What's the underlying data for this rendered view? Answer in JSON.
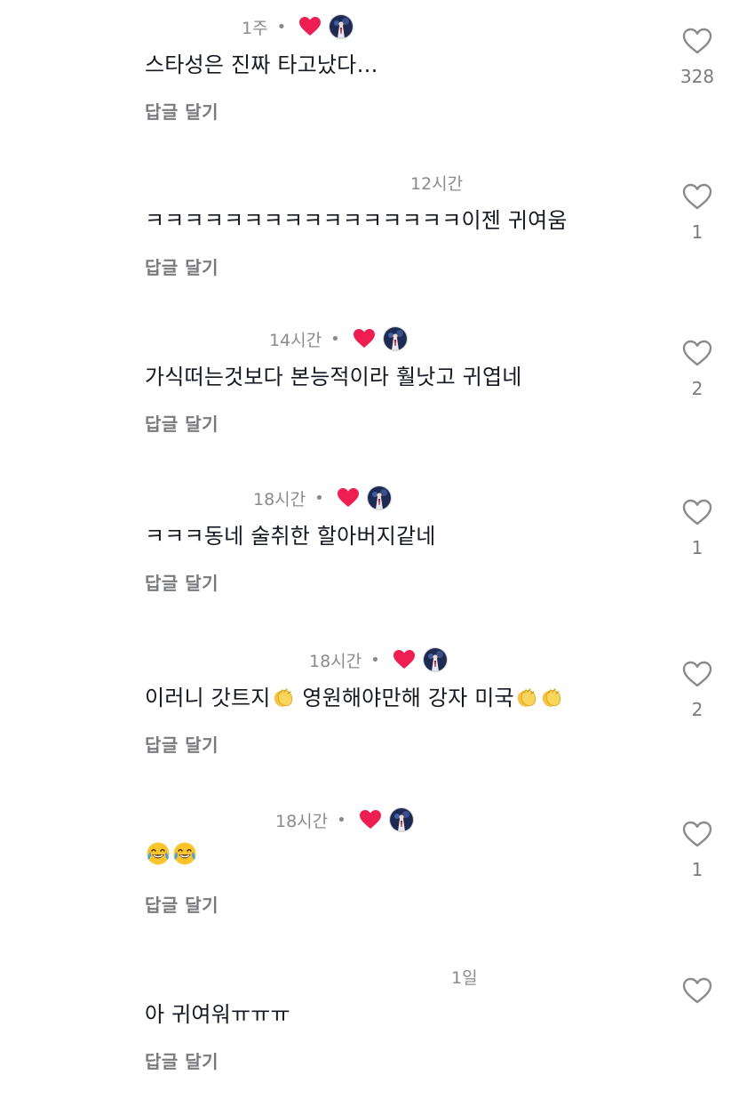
{
  "comments": [
    {
      "time": "1주",
      "creator_liked": true,
      "text_parts": [
        "스타성은 진짜 타고났다…"
      ],
      "reply_label": "답글 달기",
      "likes": "328"
    },
    {
      "time": "12시간",
      "creator_liked": false,
      "text_parts": [
        "ㅋㅋㅋㅋㅋㅋㅋㅋㅋㅋㅋㅋㅋㅋㅋㅋ이젠 귀여움"
      ],
      "reply_label": "답글 달기",
      "likes": "1"
    },
    {
      "time": "14시간",
      "creator_liked": true,
      "text_parts": [
        "가식떠는것보다 본능적이라 훨낫고 귀엽네"
      ],
      "reply_label": "답글 달기",
      "likes": "2"
    },
    {
      "time": "18시간",
      "creator_liked": true,
      "text_parts": [
        "ㅋㅋㅋ동네 술취한 할아버지같네"
      ],
      "reply_label": "답글 달기",
      "likes": "1"
    },
    {
      "time": "18시간",
      "creator_liked": true,
      "text_parts": [
        "이러니 갓트지",
        "clap-emoji",
        " 영원해야만해 강자 미국",
        "clap-emoji",
        "clap-emoji"
      ],
      "reply_label": "답글 달기",
      "likes": "2"
    },
    {
      "time": "18시간",
      "creator_liked": true,
      "text_parts": [
        "joy-emoji",
        "joy-emoji"
      ],
      "reply_label": "답글 달기",
      "likes": "1"
    },
    {
      "time": "1일",
      "creator_liked": false,
      "text_parts": [
        "아 귀여워ㅠㅠㅠ"
      ],
      "reply_label": "답글 달기",
      "likes": ""
    }
  ],
  "colors": {
    "heart_red": "#ee1d52",
    "meta_gray": "#8a8b91",
    "text": "#161823",
    "like_icon": "#8a8b91"
  },
  "icons": {
    "creator_heart": "red-heart-icon",
    "creator_avatar": "creator-avatar",
    "like": "heart-outline-icon"
  }
}
